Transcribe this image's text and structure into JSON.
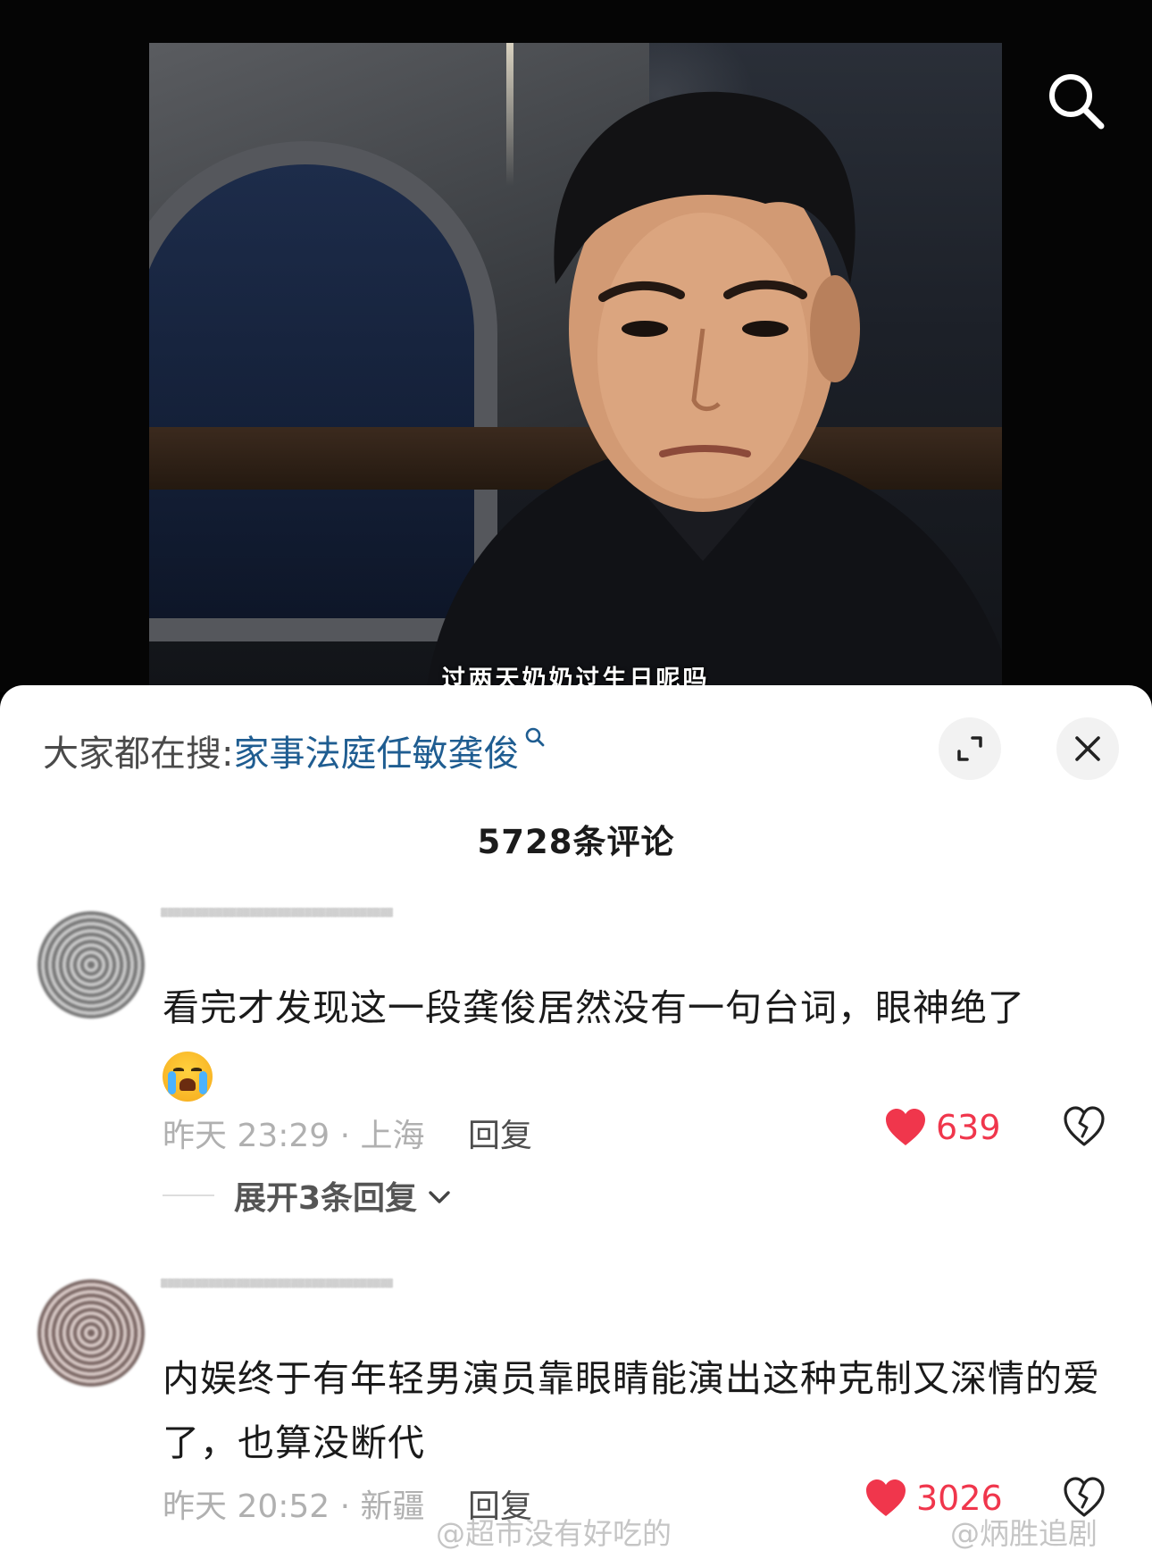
{
  "video": {
    "subtitle": "过两天奶奶过生日呢吗",
    "search_icon": "search-icon"
  },
  "panel": {
    "hot_search_label": "大家都在搜:",
    "hot_search_term": "家事法庭任敏龚俊",
    "hot_search_icon": "search-icon",
    "expand_icon": "expand-icon",
    "close_icon": "close-icon",
    "comment_count": "5728条评论",
    "accent_color": "#1f5d91",
    "like_color": "#f0364c"
  },
  "comments": [
    {
      "text": "看完才发现这一段龚俊居然没有一句台词，眼神绝了",
      "emoji": "loudly-crying-face-emoji",
      "meta": "昨天 23:29 · 上海",
      "reply_label": "回复",
      "likes": "639",
      "expand_label": "展开3条回复"
    },
    {
      "text": "内娱终于有年轻男演员靠眼睛能演出这种克制又深情的爱了，也算没断代",
      "meta": "昨天 20:52 · 新疆",
      "reply_label": "回复",
      "likes": "3026"
    }
  ],
  "watermarks": {
    "left": "@超市没有好吃的",
    "right": "@炳胜追剧"
  }
}
